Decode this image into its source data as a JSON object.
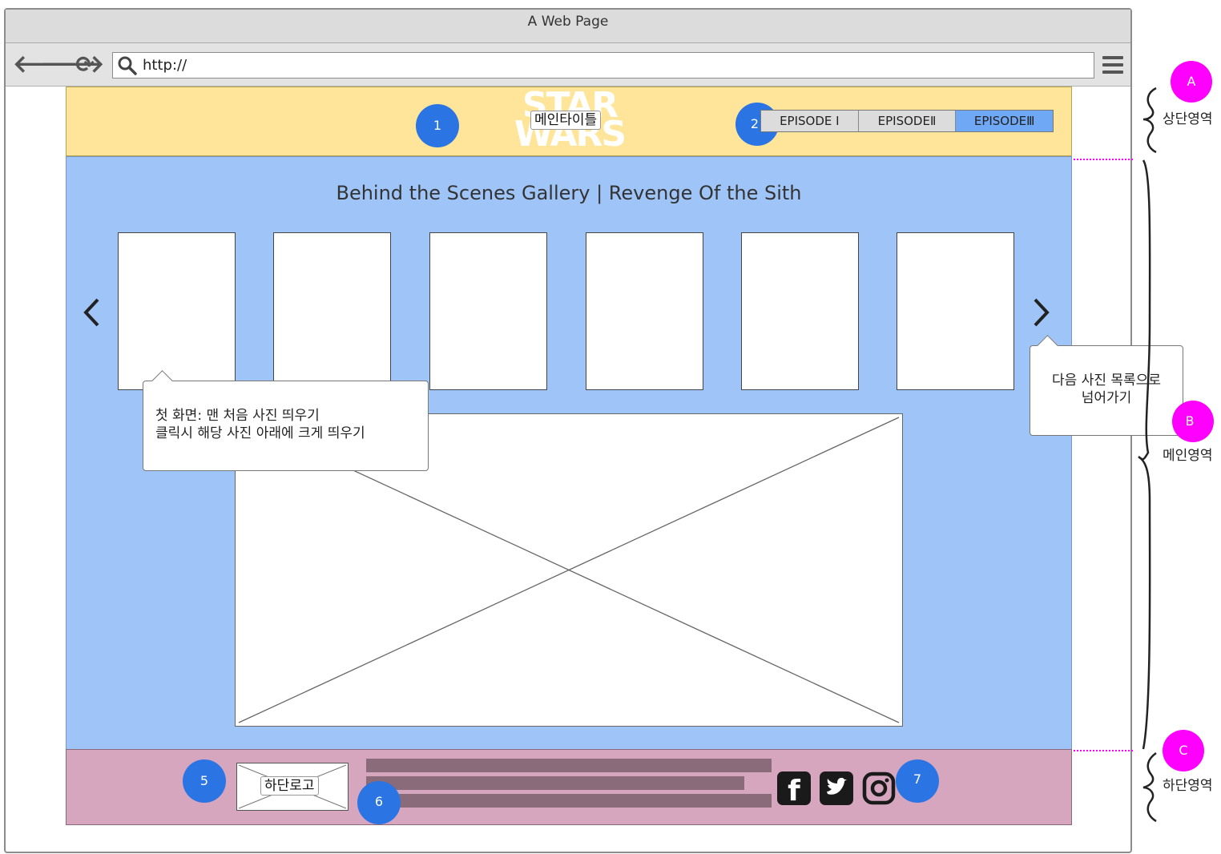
{
  "window": {
    "title": "A Web Page"
  },
  "toolbar": {
    "url": "http://"
  },
  "header": {
    "logo_tag": "메인타이틀",
    "tabs": [
      {
        "label": "EPISODE I",
        "active": false
      },
      {
        "label": "EPISODEⅡ",
        "active": false
      },
      {
        "label": "EPISODEⅢ",
        "active": true
      }
    ]
  },
  "main": {
    "gallery_title": "Behind the Scenes Gallery | Revenge Of the Sith",
    "thumbnail_count": 6
  },
  "callouts": {
    "first_line1": "첫 화면: 맨 처음 사진 띄우기",
    "first_line2": "클릭시 해당 사진 아래에 크게 띄우기",
    "next_line1": "다음 사진 목록으로",
    "next_line2": "넘어가기"
  },
  "footer": {
    "logo_tag": "하단로고"
  },
  "badges": {
    "b1": "1",
    "b2": "2",
    "b5": "5",
    "b6": "6",
    "b7": "7"
  },
  "regions": {
    "a_marker": "A",
    "a_label": "상단영역",
    "b_marker": "B",
    "b_label": "메인영역",
    "c_marker": "C",
    "c_label": "하단영역"
  },
  "colors": {
    "header_bg": "#ffe599",
    "main_bg": "#9fc5f8",
    "footer_bg": "#d5a6bd",
    "badge": "#2b74e4",
    "region_marker": "#ff00ff",
    "active_tab": "#6fa8f5"
  },
  "icons": [
    "back-arrow-icon",
    "forward-arrow-icon",
    "reload-icon",
    "search-icon",
    "hamburger-menu-icon",
    "chevron-left-icon",
    "chevron-right-icon",
    "facebook-icon",
    "twitter-icon",
    "instagram-icon"
  ]
}
